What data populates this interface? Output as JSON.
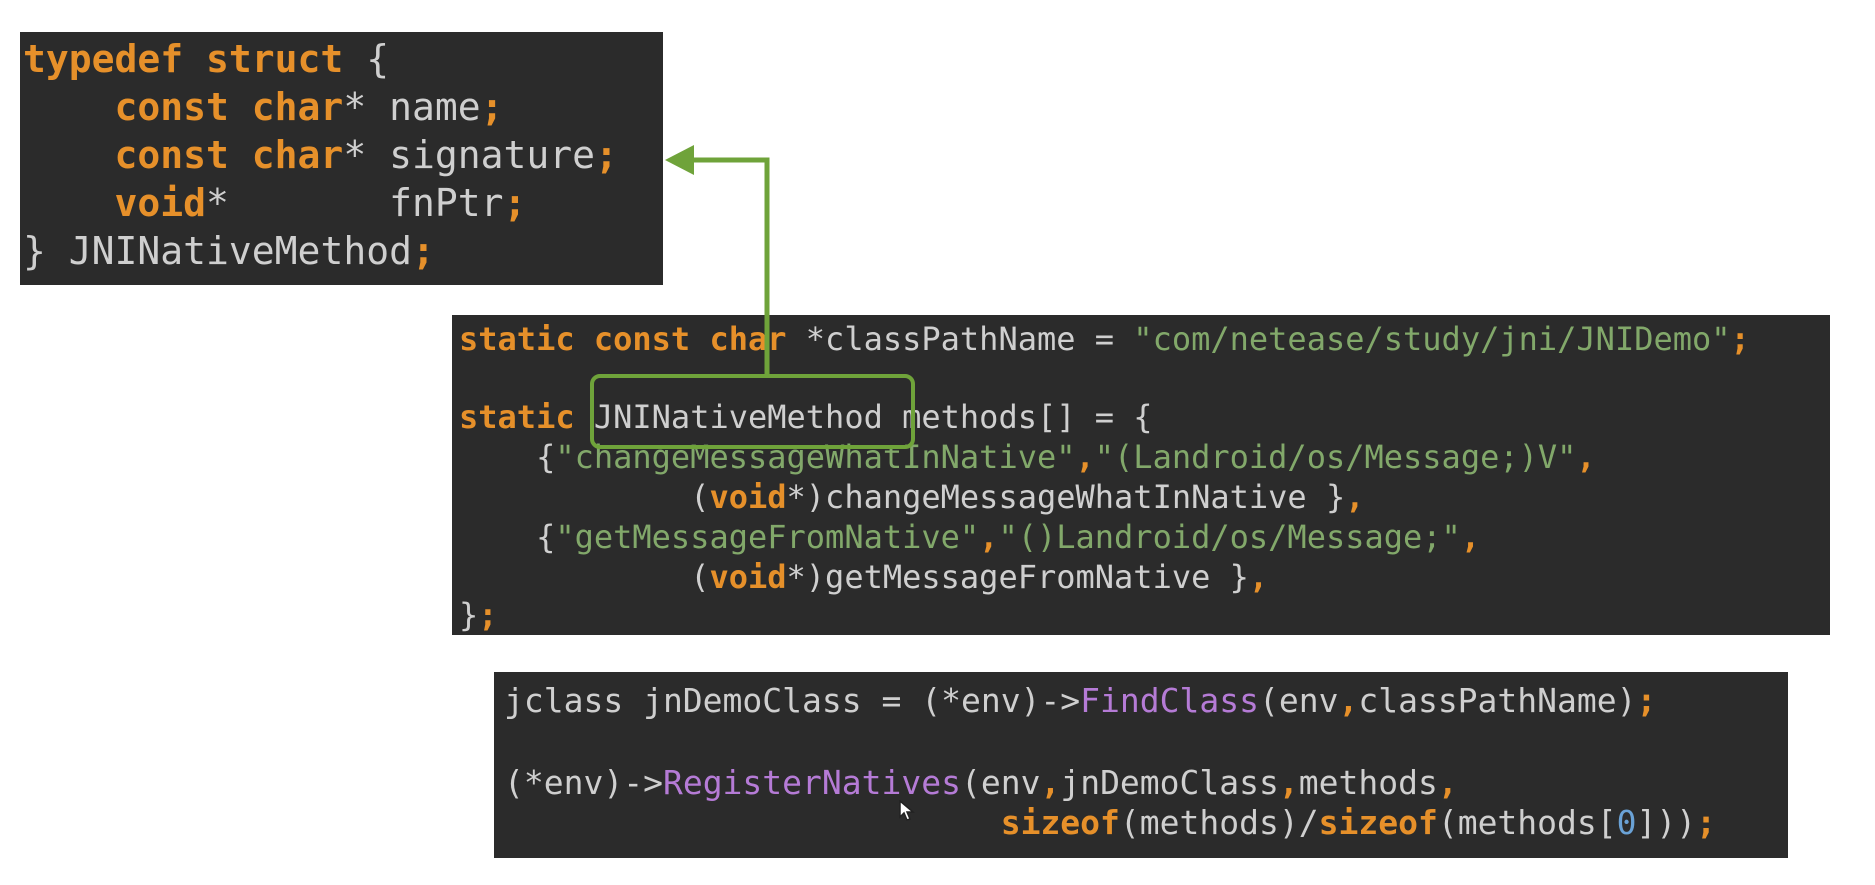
{
  "colors": {
    "background": "#ffffff",
    "code_background": "#2b2b2b",
    "keyword": "#e6902a",
    "string": "#82a86a",
    "function_call": "#b57bd6",
    "number": "#6aa2d6",
    "plain": "#cfcfcf",
    "callout": "#6fa33a"
  },
  "struct_code": {
    "l1": {
      "kw1": "typedef",
      "kw2": "struct",
      "brace": "{"
    },
    "l2": {
      "kw1": "const",
      "kw2": "char",
      "star": "*",
      "id": "name",
      "semi": ";"
    },
    "l3": {
      "kw1": "const",
      "kw2": "char",
      "star": "*",
      "id": "signature",
      "semi": ";"
    },
    "l4": {
      "kw1": "void",
      "star": "*",
      "id": "fnPtr",
      "semi": ";"
    },
    "l5": {
      "brace": "}",
      "id": "JNINativeMethod",
      "semi": ";"
    }
  },
  "methods_code": {
    "l1": {
      "kw1": "static",
      "kw2": "const",
      "kw3": "char",
      "decl": "*classPathName =",
      "str": "\"com/netease/study/jni/JNIDemo\"",
      "semi": ";"
    },
    "l2": {
      "kw1": "static",
      "type": "JNINativeMethod",
      "rest": "methods[] = {"
    },
    "l3": {
      "open": "{",
      "str1": "\"changeMessageWhatInNative\"",
      "comma1": ",",
      "str2": "\"(Landroid/os/Message;)V\"",
      "comma2": ","
    },
    "l4": {
      "open": "(",
      "kw": "void",
      "rest": "*)changeMessageWhatInNative }",
      "comma": ","
    },
    "l5": {
      "open": "{",
      "str1": "\"getMessageFromNative\"",
      "comma1": ",",
      "str2": "\"()Landroid/os/Message;\"",
      "comma2": ","
    },
    "l6": {
      "open": "(",
      "kw": "void",
      "rest": "*)getMessageFromNative }",
      "comma": ","
    },
    "l7": {
      "brace": "}",
      "semi": ";"
    }
  },
  "register_code": {
    "l1": {
      "pre": "jclass jnDemoClass = (*env)->",
      "fn": "FindClass",
      "args1": "(env",
      "comma": ",",
      "args2": "classPathName)",
      "semi": ";"
    },
    "l2": {
      "pre": "(*env)->",
      "fn": "RegisterNatives",
      "args1": "(env",
      "comma1": ",",
      "args2": "jnDemoClass",
      "comma2": ",",
      "args3": "methods",
      "comma3": ","
    },
    "l3": {
      "kw1": "sizeof",
      "mid1": "(methods)/",
      "kw2": "sizeof",
      "mid2": "(methods[",
      "num": "0",
      "end": "]))",
      "semi": ";"
    }
  }
}
